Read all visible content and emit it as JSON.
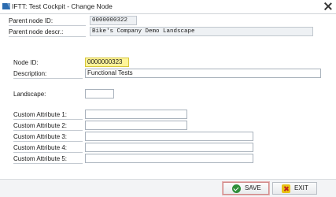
{
  "window": {
    "title": "IFTT: Test Cockpit - Change Node",
    "app_icon": "sap-logo-icon",
    "close_icon": "close-icon"
  },
  "header": {
    "parent_node_id_label": "Parent node ID:",
    "parent_node_id_value": "0000000322",
    "parent_node_descr_label": "Parent node descr.:",
    "parent_node_descr_value": "Bike's Company Demo Landscape"
  },
  "form": {
    "node_id_label": "Node ID:",
    "node_id_value": "0000000323",
    "description_label": "Description:",
    "description_value": "Functional Tests",
    "landscape_label": "Landscape:",
    "landscape_value": "",
    "custom_attributes": [
      {
        "label": "Custom Attribute 1:",
        "value": ""
      },
      {
        "label": "Custom Attribute 2:",
        "value": ""
      },
      {
        "label": "Custom Attribute 3:",
        "value": ""
      },
      {
        "label": "Custom Attribute 4:",
        "value": ""
      },
      {
        "label": "Custom Attribute 5:",
        "value": ""
      }
    ]
  },
  "footer": {
    "save_label": "SAVE",
    "save_icon": "check-icon",
    "exit_label": "EXIT",
    "exit_icon": "cancel-icon"
  },
  "colors": {
    "highlight_field": "#fff59a",
    "readonly_field": "#eef1f4",
    "save_icon": "#2f8f3a",
    "exit_icon": "#e8c213"
  }
}
